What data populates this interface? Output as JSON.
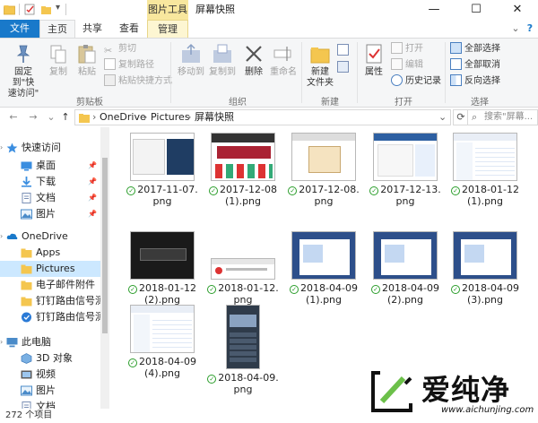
{
  "titlebar": {
    "context_tab": "图片工具",
    "title": "屏幕快照",
    "minimize": "—",
    "maximize": "☐",
    "close": "✕"
  },
  "tabs": {
    "file": "文件",
    "home": "主页",
    "share": "共享",
    "view": "查看",
    "manage": "管理",
    "expand": "⌄",
    "help": "?"
  },
  "ribbon": {
    "pin_label": "固定到\"快\n速访问\"",
    "copy": "复制",
    "paste": "粘贴",
    "cut": "剪切",
    "copy_path": "复制路径",
    "paste_shortcut": "粘贴快捷方式",
    "group_clipboard": "剪贴板",
    "move_to": "移动到",
    "copy_to": "复制到",
    "delete": "删除",
    "rename": "重命名",
    "group_organize": "组织",
    "new_folder": "新建\n文件夹",
    "group_new": "新建",
    "properties": "属性",
    "open": "打开",
    "edit": "编辑",
    "history": "历史记录",
    "group_open": "打开",
    "select_all": "全部选择",
    "select_none": "全部取消",
    "invert_selection": "反向选择",
    "group_select": "选择"
  },
  "address": {
    "back": "←",
    "forward": "→",
    "recent": "⌄",
    "up": "↑",
    "crumb_sep": "›",
    "crumbs": [
      "OneDrive",
      "Pictures",
      "屏幕快照"
    ],
    "dropdown": "⌄",
    "refresh": "⟳",
    "search_placeholder": "搜索\"屏幕..."
  },
  "nav": {
    "items": [
      {
        "label": "快速访问",
        "pinned": false
      },
      {
        "label": "桌面",
        "pinned": true
      },
      {
        "label": "下载",
        "pinned": true
      },
      {
        "label": "文档",
        "pinned": true
      },
      {
        "label": "图片",
        "pinned": true
      },
      {
        "label": "OneDrive",
        "pinned": false
      },
      {
        "label": "Apps",
        "pinned": false
      },
      {
        "label": "Pictures",
        "pinned": false
      },
      {
        "label": "电子邮件附件",
        "pinned": false
      },
      {
        "label": "钉钉路由信号测试",
        "pinned": false
      },
      {
        "label": "钉钉路由信号测试",
        "pinned": false
      },
      {
        "label": "此电脑",
        "pinned": false
      },
      {
        "label": "3D 对象",
        "pinned": false
      },
      {
        "label": "视频",
        "pinned": false
      },
      {
        "label": "图片",
        "pinned": false
      },
      {
        "label": "文档",
        "pinned": false
      }
    ]
  },
  "files": [
    {
      "name": "2017-11-07.png"
    },
    {
      "name": "2017-12-08 (1).png"
    },
    {
      "name": "2017-12-08.png"
    },
    {
      "name": "2017-12-13.png"
    },
    {
      "name": "2018-01-12 (1).png"
    },
    {
      "name": "2018-01-12 (2).png"
    },
    {
      "name": "2018-01-12.png"
    },
    {
      "name": "2018-04-09 (1).png"
    },
    {
      "name": "2018-04-09 (2).png"
    },
    {
      "name": "2018-04-09 (3).png"
    },
    {
      "name": "2018-04-09 (4).png"
    },
    {
      "name": "2018-04-09.png"
    }
  ],
  "status": {
    "count": "272 个项目"
  },
  "watermark": {
    "text": "爱纯净",
    "url": "www.aichunjing.com"
  },
  "colors": {
    "accent": "#1979ca",
    "context_tab": "#f8e79e",
    "selected": "#cce8ff",
    "sync_green": "#2a9d2a"
  }
}
